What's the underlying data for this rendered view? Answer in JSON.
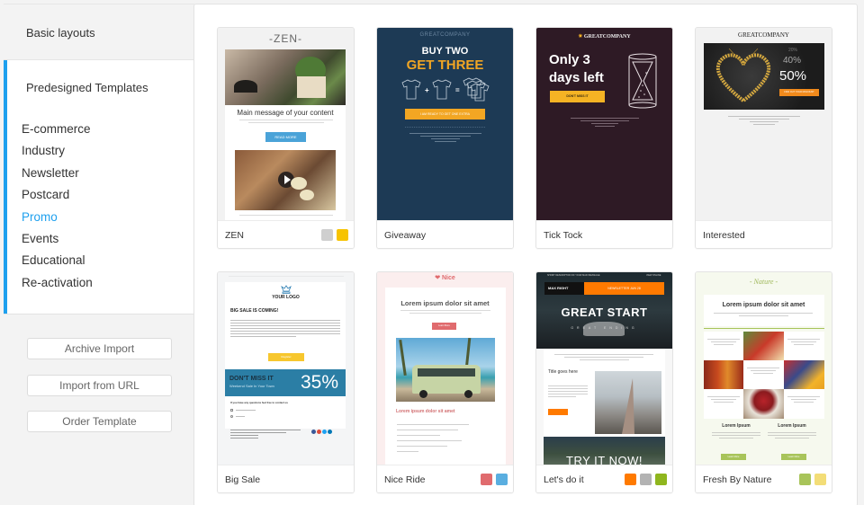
{
  "sidebar": {
    "basic_layouts_label": "Basic layouts",
    "predesigned_label": "Predesigned Templates",
    "categories": [
      {
        "label": "E-commerce",
        "selected": false
      },
      {
        "label": "Industry",
        "selected": false
      },
      {
        "label": "Newsletter",
        "selected": false
      },
      {
        "label": "Postcard",
        "selected": false
      },
      {
        "label": "Promo",
        "selected": true
      },
      {
        "label": "Events",
        "selected": false
      },
      {
        "label": "Educational",
        "selected": false
      },
      {
        "label": "Re-activation",
        "selected": false
      }
    ],
    "buttons": {
      "archive_import": "Archive Import",
      "import_from_url": "Import from URL",
      "order_template": "Order Template"
    },
    "accent_color": "#1ea0ee"
  },
  "templates": [
    {
      "name": "ZEN",
      "swatches": [
        "#cfcfcf",
        "#f7c300"
      ],
      "preview": {
        "brand": "-ZEN-",
        "headline": "Main message of your content",
        "button": "READ MORE"
      }
    },
    {
      "name": "Giveaway",
      "swatches": [],
      "preview": {
        "brand": "GREATCOMPANY",
        "line1": "BUY TWO",
        "line2": "GET THREE",
        "button": "I AM READY TO GET ONE EXTRA"
      }
    },
    {
      "name": "Tick Tock",
      "swatches": [],
      "preview": {
        "brand": "GREATCOMPANY",
        "brand_accent": "GREAT",
        "headline_1": "Only 3",
        "headline_2": "days left",
        "button": "DON'T MISS IT"
      }
    },
    {
      "name": "Interested",
      "swatches": [],
      "preview": {
        "brand": "GREATCOMPANY",
        "pct1": "20%",
        "pct2": "40%",
        "pct3": "50%",
        "button": "FIND OUT YOUR DISCOUNT"
      }
    },
    {
      "name": "Big Sale",
      "swatches": [],
      "preview": {
        "logo": "YOUR LOGO",
        "headline": "BIG SALE IS COMING!",
        "button": "Register",
        "banner_title": "DON'T MISS IT",
        "banner_sub": "Weekend Sale In Your Town",
        "banner_pct": "35%",
        "contact": "If you have any questions feel free to contact us"
      }
    },
    {
      "name": "Nice Ride",
      "swatches": [
        "#e06b6e",
        "#5aaee0"
      ],
      "preview": {
        "brand": "Nice",
        "headline": "Lorem ipsum dolor sit amet",
        "button": "Learn More",
        "subhead": "Lorem ipsum dolor sit amet"
      }
    },
    {
      "name": "Let's do it",
      "swatches": [
        "#ff7a00",
        "#b3b3b3",
        "#8fb61e"
      ],
      "preview": {
        "top_left": "SHORT DESCRIPTION OF YOUR MAIN MESSAGE",
        "top_right": "VIEW ONLINE",
        "logo": "MAX RIGHT",
        "newsletter": "NEWSLETTER JUN 28",
        "hero": "GREAT START",
        "hero_sub": "GREAT ENDING",
        "title": "Title goes here",
        "cta": "TRY IT NOW!"
      }
    },
    {
      "name": "Fresh By Nature",
      "swatches": [
        "#a8c45a",
        "#f3dd77"
      ],
      "preview": {
        "brand": "- Nature -",
        "headline": "Lorem ipsum dolor sit amet",
        "col_title": "Lorem Ipsum",
        "button": "Learn More"
      }
    }
  ]
}
